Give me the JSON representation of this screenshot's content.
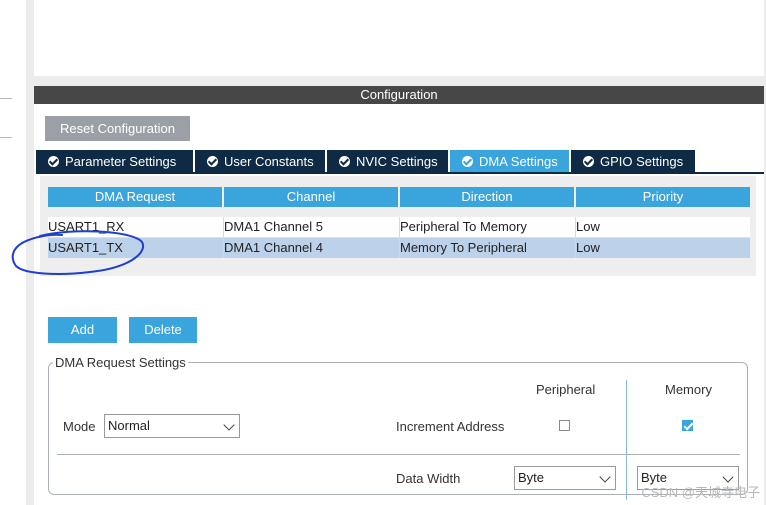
{
  "panel": {
    "title": "Configuration"
  },
  "reset_button": "Reset Configuration",
  "tabs": [
    {
      "label": "Parameter Settings",
      "active": false
    },
    {
      "label": "User Constants",
      "active": false
    },
    {
      "label": "NVIC Settings",
      "active": false
    },
    {
      "label": "DMA Settings",
      "active": true
    },
    {
      "label": "GPIO Settings",
      "active": false
    }
  ],
  "table": {
    "headers": [
      "DMA Request",
      "Channel",
      "Direction",
      "Priority"
    ],
    "rows": [
      {
        "request": "USART1_RX",
        "channel": "DMA1 Channel 5",
        "direction": "Peripheral To Memory",
        "priority": "Low",
        "selected": false
      },
      {
        "request": "USART1_TX",
        "channel": "DMA1 Channel 4",
        "direction": "Memory To Peripheral",
        "priority": "Low",
        "selected": true
      }
    ]
  },
  "actions": {
    "add": "Add",
    "delete": "Delete"
  },
  "request_settings": {
    "legend": "DMA Request Settings",
    "mode_label": "Mode",
    "mode_value": "Normal",
    "peripheral_label": "Peripheral",
    "memory_label": "Memory",
    "increment_label": "Increment Address",
    "peripheral_increment": false,
    "memory_increment": true,
    "data_width_label": "Data Width",
    "peripheral_width": "Byte",
    "memory_width": "Byte"
  },
  "watermark": "CSDN @天城寺电子",
  "colors": {
    "accent": "#3aa4dc",
    "tab_dark": "#0e2a45",
    "header": "#474747",
    "selected_row": "#bcd2ea",
    "annotation": "#1f3fcf"
  }
}
